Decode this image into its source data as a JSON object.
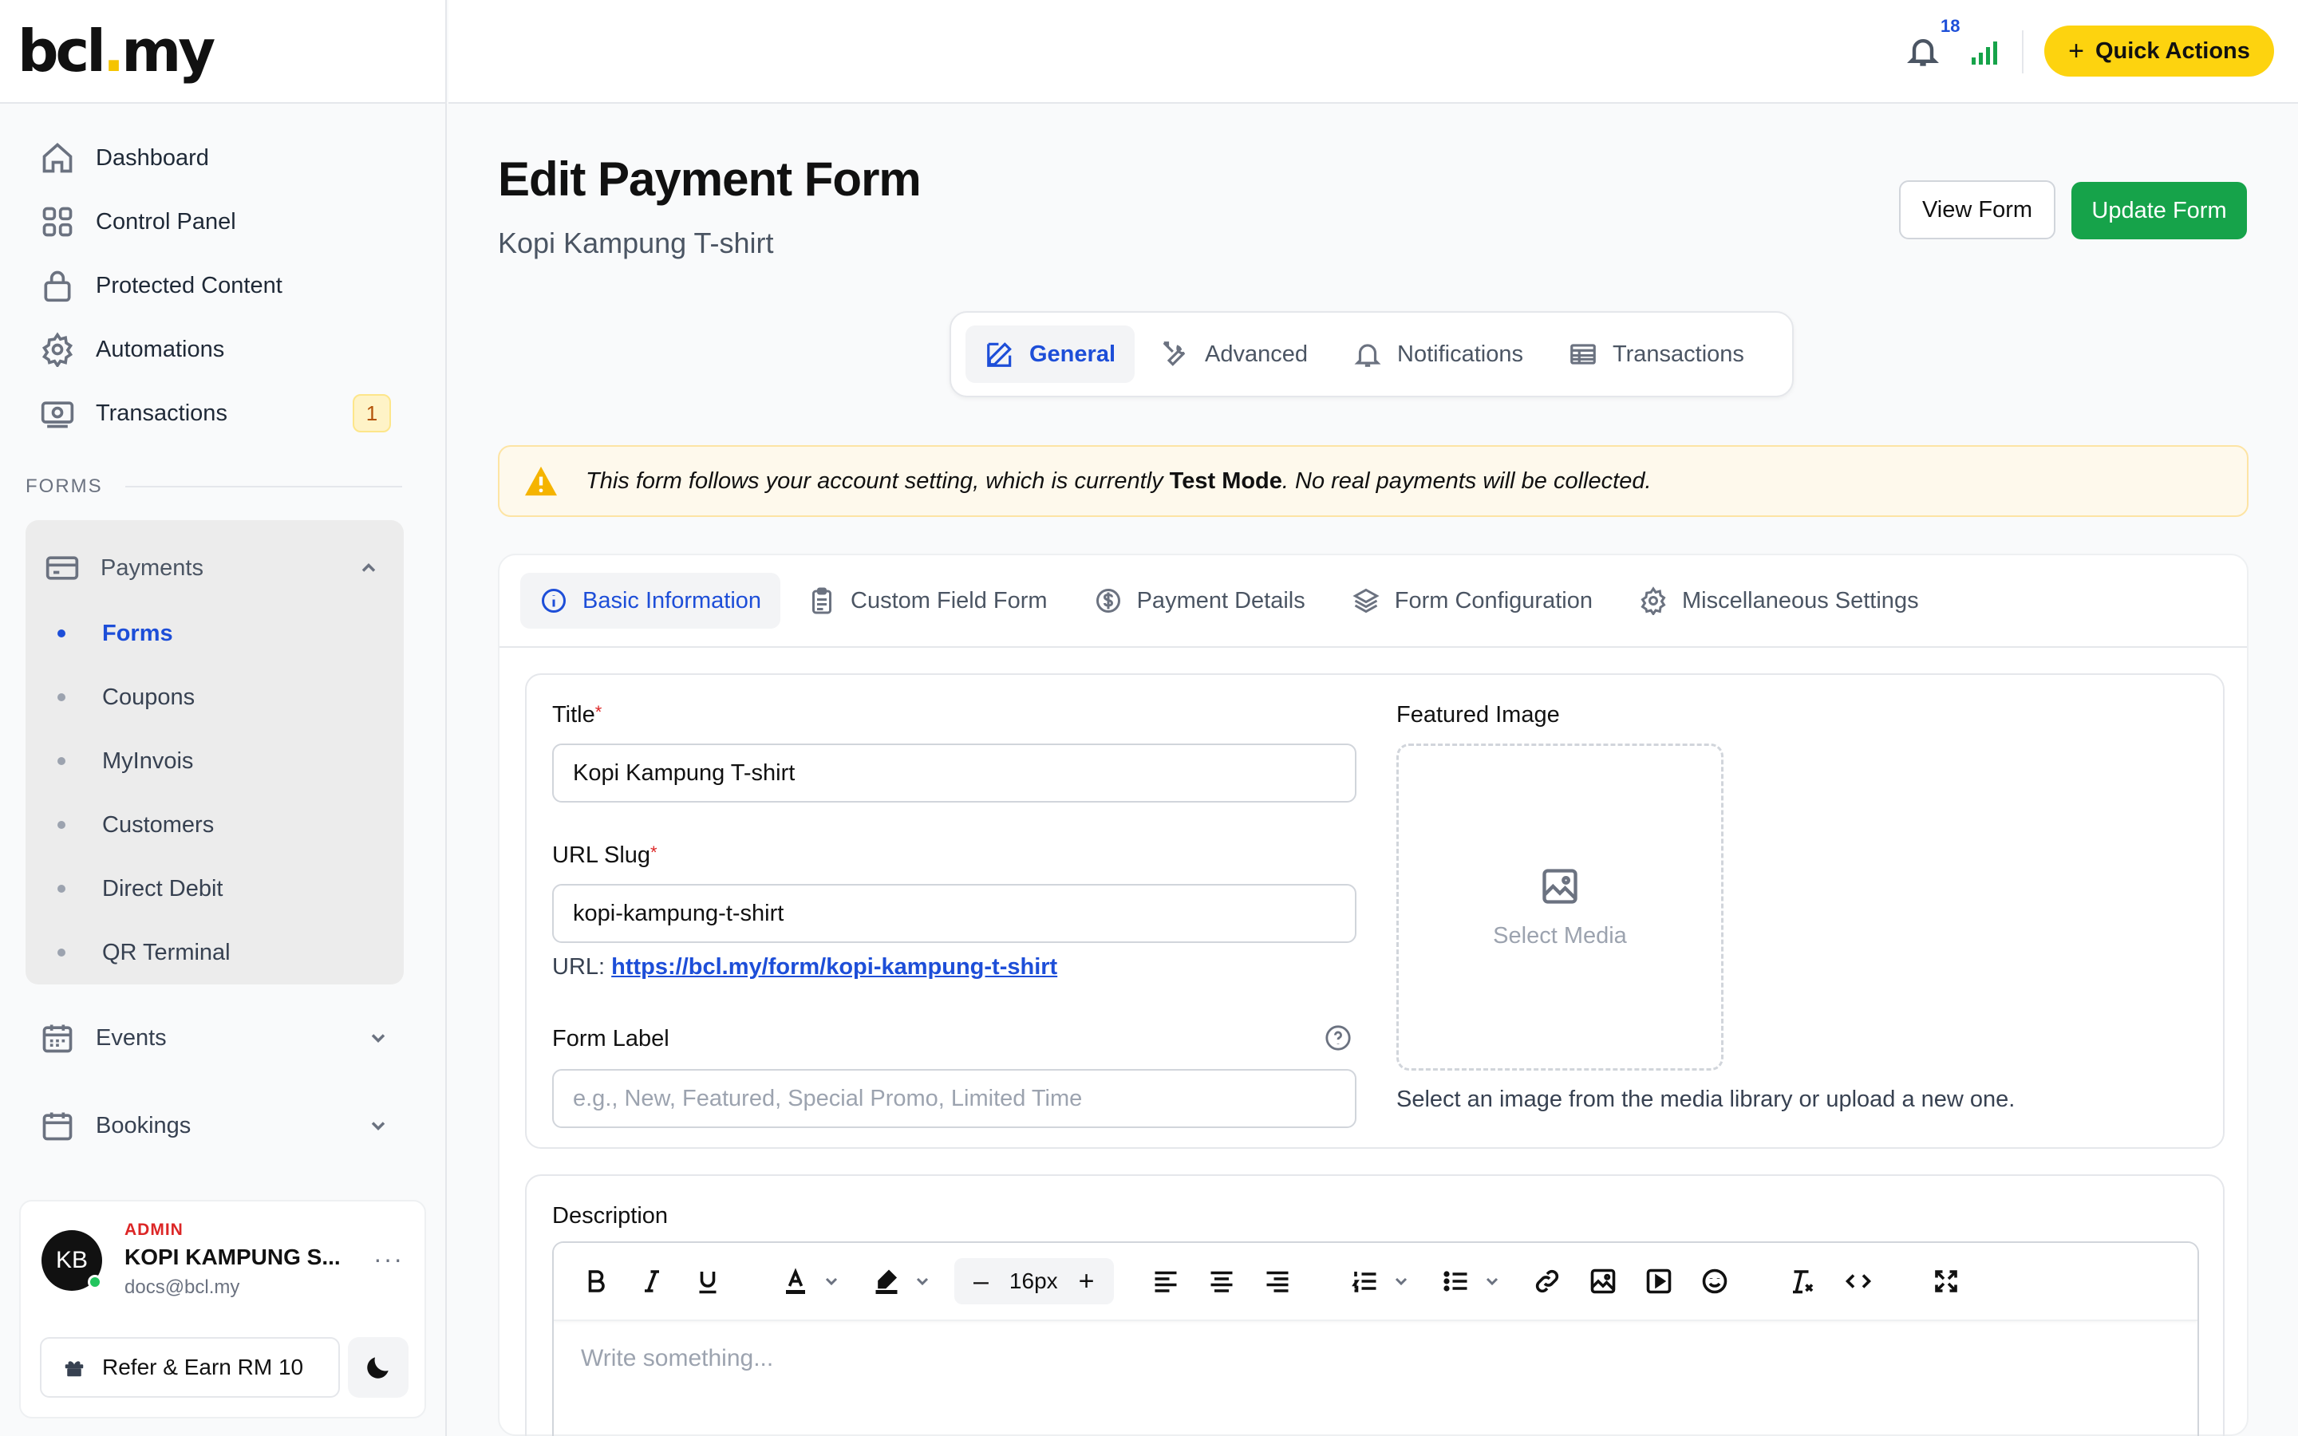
{
  "brand": {
    "logo_main": "bcl",
    "logo_dot": ".",
    "logo_tail": "my",
    "accent": "#fdd30f"
  },
  "sidebar": {
    "items": [
      {
        "label": "Dashboard",
        "icon": "home-icon"
      },
      {
        "label": "Control Panel",
        "icon": "grid-icon"
      },
      {
        "label": "Protected Content",
        "icon": "lock-icon"
      },
      {
        "label": "Automations",
        "icon": "gear-icon"
      },
      {
        "label": "Transactions",
        "icon": "money-icon",
        "badge": "1"
      }
    ],
    "section_forms": "FORMS",
    "payments": {
      "label": "Payments",
      "children": [
        "Forms",
        "Coupons",
        "MyInvois",
        "Customers",
        "Direct Debit",
        "QR Terminal"
      ],
      "active": "Forms"
    },
    "events": "Events",
    "bookings": "Bookings",
    "account": {
      "initials": "KB",
      "role": "ADMIN",
      "name": "KOPI KAMPUNG S...",
      "email": "docs@bcl.my",
      "more": "···",
      "refer_label": "Refer & Earn RM 10"
    }
  },
  "topbar": {
    "notif_count": "18",
    "quick_actions": "Quick Actions",
    "quick_plus": "+"
  },
  "page": {
    "title": "Edit Payment Form",
    "subtitle": "Kopi Kampung T-shirt",
    "view_button": "View Form",
    "update_button": "Update Form",
    "update_color": "#16a34a"
  },
  "main_tabs": [
    {
      "label": "General",
      "icon": "edit-icon",
      "active": true
    },
    {
      "label": "Advanced",
      "icon": "tools-icon"
    },
    {
      "label": "Notifications",
      "icon": "bell-icon"
    },
    {
      "label": "Transactions",
      "icon": "table-icon"
    }
  ],
  "alert": {
    "prefix": "This form follows your account setting, which is currently",
    "mode": "Test Mode",
    "suffix": ". No real payments will be collected."
  },
  "sub_tabs": [
    {
      "label": "Basic Information",
      "icon": "info-icon",
      "active": true
    },
    {
      "label": "Custom Field Form",
      "icon": "clipboard-icon"
    },
    {
      "label": "Payment Details",
      "icon": "dollar-icon"
    },
    {
      "label": "Form Configuration",
      "icon": "layers-icon"
    },
    {
      "label": "Miscellaneous Settings",
      "icon": "cog-icon"
    }
  ],
  "form": {
    "title_label": "Title",
    "title_value": "Kopi Kampung T-shirt",
    "slug_label": "URL Slug",
    "slug_value": "kopi-kampung-t-shirt",
    "url_prefix": "URL:",
    "url_value": "https://bcl.my/form/kopi-kampung-t-shirt",
    "form_label_label": "Form Label",
    "form_label_placeholder": "e.g., New, Featured, Special Promo, Limited Time",
    "required_mark": "*",
    "featured_label": "Featured Image",
    "select_media": "Select Media",
    "media_help": "Select an image from the media library or upload a new one."
  },
  "description": {
    "label": "Description",
    "font_size": "16px",
    "minus": "–",
    "plus": "+",
    "placeholder": "Write something..."
  }
}
